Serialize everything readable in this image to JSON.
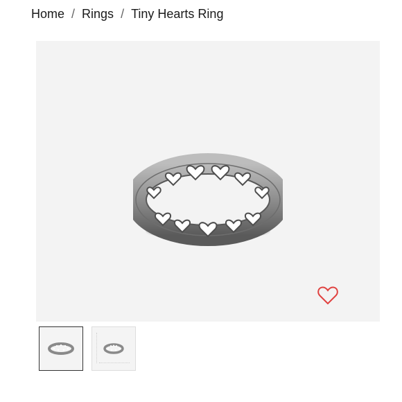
{
  "breadcrumb": {
    "items": [
      {
        "label": "Home"
      },
      {
        "label": "Rings"
      }
    ],
    "separator": "/",
    "current": "Tiny Hearts Ring"
  },
  "gallery": {
    "background_color": "#f3f3f3",
    "wishlist_icon": "heart-outline-icon",
    "wishlist_color": "#e0413f",
    "thumbnails": [
      {
        "name": "thumbnail-1",
        "selected": true
      },
      {
        "name": "thumbnail-2",
        "selected": false
      }
    ]
  }
}
